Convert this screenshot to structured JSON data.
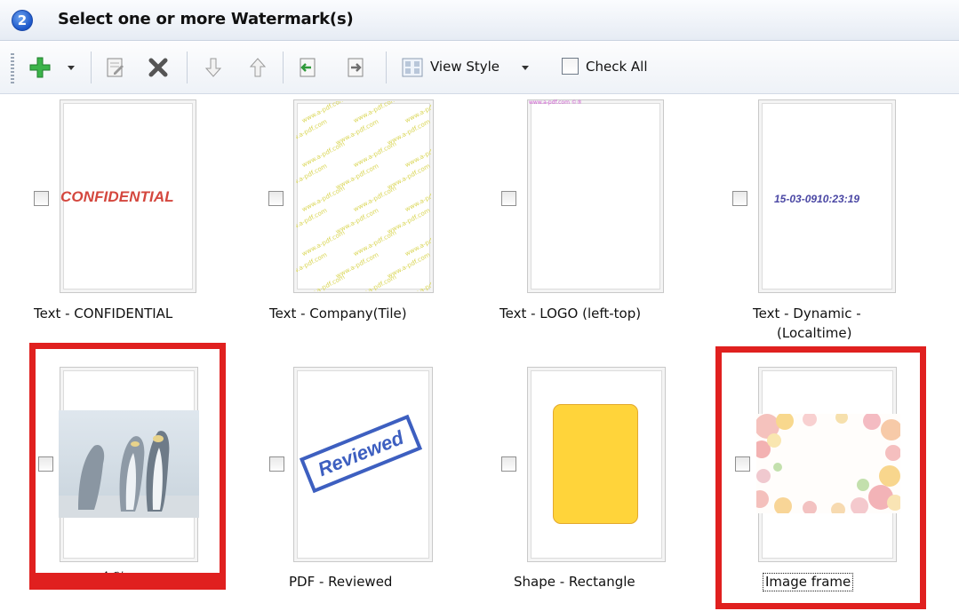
{
  "header": {
    "step": "2",
    "title": "Select one or more Watermark(s)"
  },
  "toolbar": {
    "view_style_label": "View Style",
    "check_all_label": "Check All"
  },
  "watermarks": [
    {
      "caption": "Text - CONFIDENTIAL",
      "preview_text": "CONFIDENTIAL"
    },
    {
      "caption": "Text - Company(Tile)",
      "preview_text": "www.a-pdf.com"
    },
    {
      "caption": "Text - LOGO (left-top)",
      "preview_text": "www.a-pdf.com ©®"
    },
    {
      "caption_line1": "Text - Dynamic -",
      "caption_line2": "(Localtime)",
      "preview_text": "15-03-0910:23:19"
    },
    {
      "caption": "企鹅"
    },
    {
      "caption": "PDF - Reviewed",
      "preview_text": "Reviewed"
    },
    {
      "caption": "Shape - Rectangle"
    },
    {
      "caption": "Image frame"
    }
  ],
  "colors": {
    "highlight": "#e0201f",
    "confidential": "#d4473e",
    "dynamic": "#4a47a4",
    "logo": "#d05bd2",
    "stamp": "#3d5fc0",
    "shape_fill": "#ffd43a"
  },
  "icons": [
    "add-icon",
    "edit-icon",
    "delete-icon",
    "move-down-icon",
    "move-up-icon",
    "import-icon",
    "export-icon",
    "view-style-icon"
  ]
}
